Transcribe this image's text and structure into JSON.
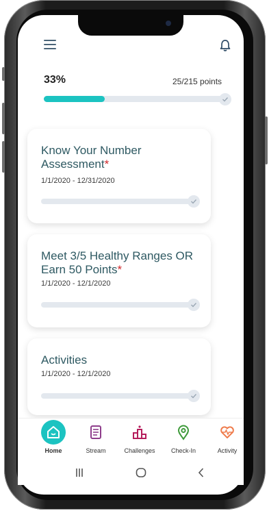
{
  "progress": {
    "percent_label": "33%",
    "points_label": "25/215 points",
    "fraction": 0.33
  },
  "cards": [
    {
      "title": "Know Your Number Assessment",
      "required_mark": "*",
      "dates": "1/1/2020 - 12/31/2020"
    },
    {
      "title": "Meet 3/5 Healthy Ranges OR Earn 50 Points",
      "required_mark": "*",
      "dates": "1/1/2020 - 12/1/2020"
    },
    {
      "title": "Activities",
      "required_mark": "",
      "dates": "1/1/2020 - 12/1/2020"
    }
  ],
  "nav": {
    "home": "Home",
    "stream": "Stream",
    "challenges": "Challenges",
    "checkin": "Check-In",
    "activity": "Activity"
  },
  "icons": {
    "menu": "hamburger-menu-icon",
    "bell": "bell-icon",
    "check": "check-icon",
    "home": "house-icon",
    "stream": "document-icon",
    "challenges": "podium-icon",
    "checkin": "location-pin-icon",
    "activity": "heart-pulse-icon"
  },
  "colors": {
    "accent": "#1cc3c1",
    "title": "#2e5962",
    "required": "#d0272a",
    "stream": "#8e3d8b",
    "challenges": "#b51d5b",
    "checkin": "#3e9a3a",
    "activity": "#ef7b4b"
  }
}
